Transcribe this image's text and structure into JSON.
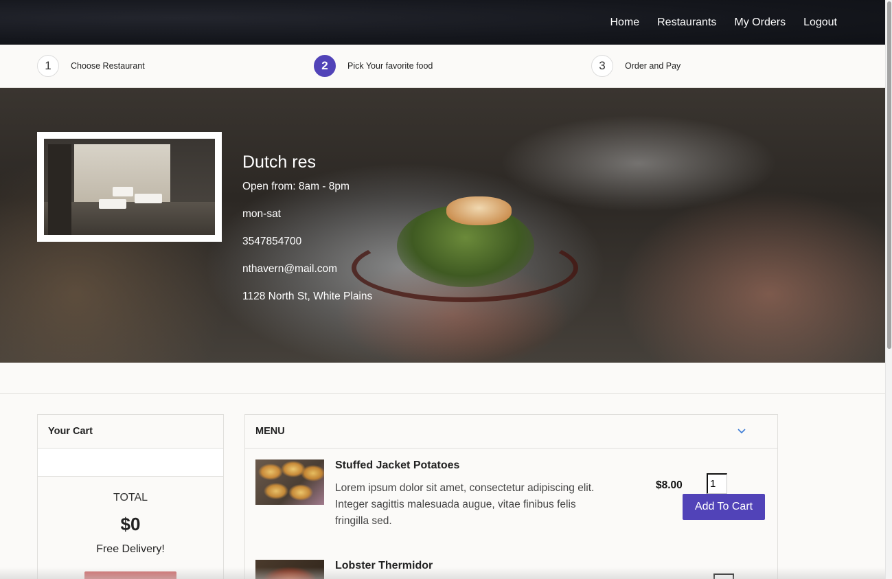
{
  "nav": {
    "links": [
      "Home",
      "Restaurants",
      "My Orders",
      "Logout"
    ]
  },
  "steps": [
    {
      "number": "1",
      "label": "Choose Restaurant",
      "active": false
    },
    {
      "number": "2",
      "label": "Pick Your favorite food",
      "active": true
    },
    {
      "number": "3",
      "label": "Order and Pay",
      "active": false
    }
  ],
  "restaurant": {
    "name": "Dutch res",
    "hours": "Open from: 8am - 8pm",
    "days": "mon-sat",
    "phone": "3547854700",
    "email": "nthavern@mail.com",
    "address": "1128 North St, White Plains"
  },
  "cart": {
    "title": "Your Cart",
    "total_label": "TOTAL",
    "total_value": "$0",
    "delivery_note": "Free Delivery!"
  },
  "menu": {
    "title": "MENU",
    "items": [
      {
        "name": "Stuffed Jacket Potatoes",
        "description": "Lorem ipsum dolor sit amet, consectetur adipiscing elit. Integer sagittis malesuada augue, vitae finibus felis fringilla sed.",
        "price": "$8.00",
        "quantity": "1",
        "add_label": "Add To Cart"
      },
      {
        "name": "Lobster Thermidor"
      }
    ]
  },
  "colors": {
    "accent": "#5143b8",
    "checkout": "#cf6b6b",
    "nav_bg": "#15171d"
  }
}
